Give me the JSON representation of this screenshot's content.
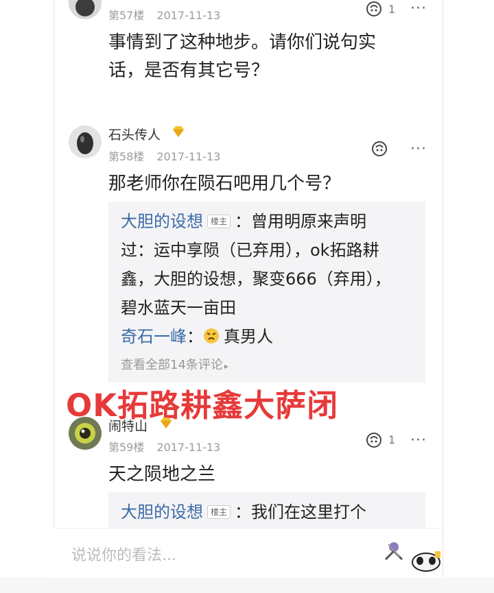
{
  "comments": [
    {
      "floor": "第57楼",
      "date": "2017-11-13",
      "likes": "1",
      "content_lines": [
        "事情到了这种地步。请你们说句实",
        "话，是否有其它号？"
      ]
    },
    {
      "username": "石头传人",
      "floor": "第58楼",
      "date": "2017-11-13",
      "content": "那老师你在陨石吧用几个号？",
      "replies": {
        "op_badge": "楼主",
        "r1_nick": "大胆的设想",
        "r1_lines": [
          "：曾用明原来声明",
          "过：运中享陨（已弃用），ok拓路耕",
          "鑫，大胆的设想，聚变666（弃用），",
          "碧水蓝天一亩田"
        ],
        "r2_nick": "奇石一峰",
        "r2_sep": "：",
        "r2_text": "真男人",
        "view_all": "查看全部14条评论"
      }
    },
    {
      "username": "闹特山",
      "floor": "第59楼",
      "date": "2017-11-13",
      "likes": "1",
      "content": "天之陨地之兰",
      "reply_nick": "大胆的设想",
      "reply_text": "：我们在这里打个"
    }
  ],
  "overlay_text": "OK拓路耕鑫大萨闭",
  "input_placeholder": "说说你的看法...",
  "more_glyph": "···",
  "colors": {
    "nick_blue": "#3a6aa6",
    "overlay_red": "#e63a3a"
  }
}
